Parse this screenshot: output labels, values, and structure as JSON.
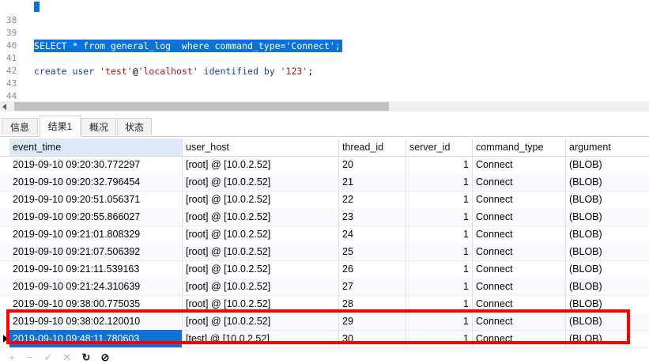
{
  "editor": {
    "lines": [
      {
        "no": "38",
        "text": ""
      },
      {
        "no": "39",
        "text": "SELECT * from general_log  where command_type='Connect';"
      },
      {
        "no": "40",
        "text": ""
      },
      {
        "no": "41",
        "text": "create user 'test'@'localhost' identified by '123';"
      },
      {
        "no": "42",
        "text": ""
      },
      {
        "no": "43",
        "text": ""
      },
      {
        "no": "44",
        "text": ""
      }
    ],
    "line41_parts": {
      "kw1": "create user ",
      "s1": "'test'",
      "at": "@",
      "s2": "'localhost'",
      "kw2": " identified by ",
      "s3": "'123'",
      "end": ";"
    }
  },
  "tabs": [
    {
      "label": "信息",
      "active": false
    },
    {
      "label": "结果1",
      "active": true
    },
    {
      "label": "概况",
      "active": false
    },
    {
      "label": "状态",
      "active": false
    }
  ],
  "grid": {
    "columns": [
      "event_time",
      "user_host",
      "thread_id",
      "server_id",
      "command_type",
      "argument"
    ],
    "rows": [
      [
        "2019-09-10 09:20:30.772297",
        "[root] @  [10.0.2.52]",
        "20",
        "1",
        "Connect",
        "(BLOB)"
      ],
      [
        "2019-09-10 09:20:32.796454",
        "[root] @  [10.0.2.52]",
        "21",
        "1",
        "Connect",
        "(BLOB)"
      ],
      [
        "2019-09-10 09:20:51.056371",
        "[root] @  [10.0.2.52]",
        "22",
        "1",
        "Connect",
        "(BLOB)"
      ],
      [
        "2019-09-10 09:20:55.866027",
        "[root] @  [10.0.2.52]",
        "23",
        "1",
        "Connect",
        "(BLOB)"
      ],
      [
        "2019-09-10 09:21:01.808329",
        "[root] @  [10.0.2.52]",
        "24",
        "1",
        "Connect",
        "(BLOB)"
      ],
      [
        "2019-09-10 09:21:07.506392",
        "[root] @  [10.0.2.52]",
        "25",
        "1",
        "Connect",
        "(BLOB)"
      ],
      [
        "2019-09-10 09:21:11.539163",
        "[root] @  [10.0.2.52]",
        "26",
        "1",
        "Connect",
        "(BLOB)"
      ],
      [
        "2019-09-10 09:21:24.310639",
        "[root] @  [10.0.2.52]",
        "27",
        "1",
        "Connect",
        "(BLOB)"
      ],
      [
        "2019-09-10 09:38:00.775035",
        "[root] @  [10.0.2.52]",
        "28",
        "1",
        "Connect",
        "(BLOB)"
      ],
      [
        "2019-09-10 09:38:02.120010",
        "[root] @  [10.0.2.52]",
        "29",
        "1",
        "Connect",
        "(BLOB)"
      ],
      [
        "2019-09-10 09:48:11.780603",
        "[test] @  [10.0.2.52]",
        "30",
        "1",
        "Connect",
        "(BLOB)"
      ]
    ],
    "current_row": 10
  },
  "toolbar": {
    "buttons": [
      {
        "icon": "plus-icon",
        "glyph": "+"
      },
      {
        "icon": "minus-icon",
        "glyph": "−"
      },
      {
        "icon": "check-icon",
        "glyph": "✓"
      },
      {
        "icon": "cross-icon",
        "glyph": "✕"
      },
      {
        "icon": "refresh-icon",
        "glyph": "↻"
      },
      {
        "icon": "stop-icon",
        "glyph": "⊘"
      }
    ]
  },
  "colors": {
    "selection": "#0a72d8",
    "highlight_box": "#ff0000"
  }
}
